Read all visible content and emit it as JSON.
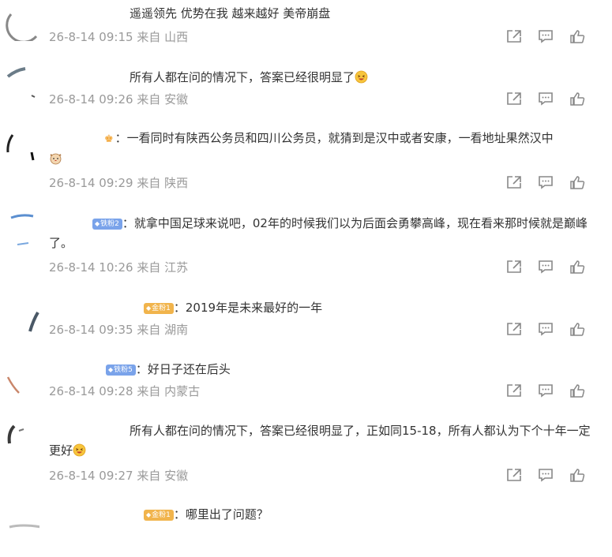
{
  "comments": [
    {
      "segments": [
        "遥遥领先 优势在我 越来越好 美帝崩盘"
      ],
      "date": "26-8-14 09:15",
      "from_label": "来自",
      "location": "山西"
    },
    {
      "segments": [
        "所有人都在问的情况下，答案已经很明显了"
      ],
      "date": "26-8-14 09:26",
      "from_label": "来自",
      "location": "安徽"
    },
    {
      "segments": [
        "：一看同时有陕西公务员和四川公务员，就猜到是汉中或者安康，一看地址果然汉中"
      ],
      "date": "26-8-14 09:29",
      "from_label": "来自",
      "location": "陕西"
    },
    {
      "badge": "铁粉2",
      "segments": [
        "：就拿中国足球来说吧，02年的时候我们以为后面会勇攀高峰，现在看来那时候就是巅峰了。"
      ],
      "date": "26-8-14 10:26",
      "from_label": "来自",
      "location": "江苏"
    },
    {
      "badge": "金粉1",
      "segments": [
        "：2019年是未来最好的一年"
      ],
      "date": "26-8-14 09:35",
      "from_label": "来自",
      "location": "湖南"
    },
    {
      "badge": "铁粉5",
      "segments": [
        "：好日子还在后头"
      ],
      "date": "26-8-14 09:28",
      "from_label": "来自",
      "location": "内蒙古"
    },
    {
      "segments": [
        "所有人都在问的情况下，答案已经很明显了，正如同15-18，所有人都认为下个十年一定更好"
      ],
      "date": "26-8-14 09:27",
      "from_label": "来自",
      "location": "安徽"
    },
    {
      "badge": "金粉1",
      "segments": [
        "：哪里出了问题？"
      ]
    }
  ],
  "icons": {
    "share": "share-icon",
    "comment": "comment-icon",
    "like": "like-icon",
    "emoji_laugh": "laughing-face-emoji",
    "emoji_cat": "cat-face-emoji",
    "crown": "crown-badge-icon"
  },
  "colors": {
    "meta": "#9a9a9a",
    "badge_blue": "#7aa3ea",
    "badge_gold": "#f1b44c",
    "icon": "#888888"
  }
}
